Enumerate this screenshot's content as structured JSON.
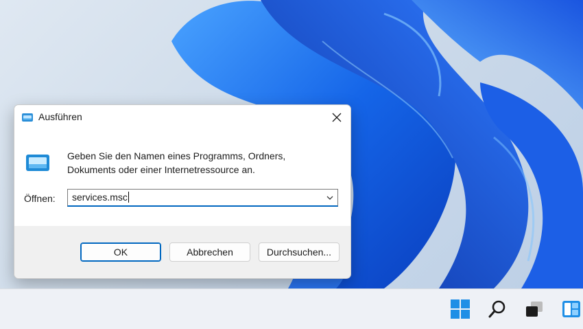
{
  "dialog": {
    "title": "Ausführen",
    "description_line1": "Geben Sie den Namen eines Programms, Ordners,",
    "description_line2": "Dokuments oder einer Internetressource an.",
    "open_label": "Öffnen:",
    "open_value": "services.msc",
    "ok_label": "OK",
    "cancel_label": "Abbrechen",
    "browse_label": "Durchsuchen..."
  },
  "taskbar": {
    "icons": [
      "windows-start-icon",
      "search-icon",
      "task-view-icon",
      "widgets-icon"
    ]
  },
  "colors": {
    "accent": "#0067c0",
    "windows_blue": "#1f8fe6"
  }
}
